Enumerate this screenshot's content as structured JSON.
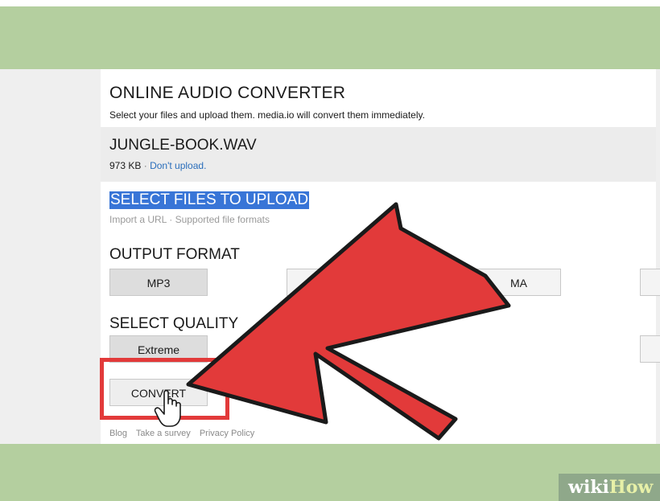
{
  "app": {
    "title": "ONLINE AUDIO CONVERTER",
    "subtitle": "Select your files and upload them. media.io will convert them immediately."
  },
  "file": {
    "name": "JUNGLE-BOOK.WAV",
    "size": "973 KB",
    "separator": "·",
    "dont_upload": "Don't upload."
  },
  "upload": {
    "heading": "SELECT FILES TO UPLOAD",
    "links": "Import a URL · Supported file formats"
  },
  "output_format": {
    "heading": "OUTPUT FORMAT",
    "selected": "MP3",
    "partial_label": "MA"
  },
  "quality": {
    "heading": "SELECT QUALITY",
    "selected": "Extreme"
  },
  "convert": {
    "label": "CONVERT"
  },
  "footer": {
    "blog": "Blog",
    "survey": "Take a survey",
    "privacy": "Privacy Policy"
  },
  "watermark": {
    "wiki": "wiki",
    "how": "How"
  },
  "colors": {
    "band_green": "#b4cf9f",
    "arrow_red": "#e23a3a",
    "selection_blue": "#3875d7",
    "link_blue": "#2a6ebb"
  },
  "icons": {
    "pointer": "hand-pointer-icon",
    "arrow": "red-arrow-annotation"
  }
}
